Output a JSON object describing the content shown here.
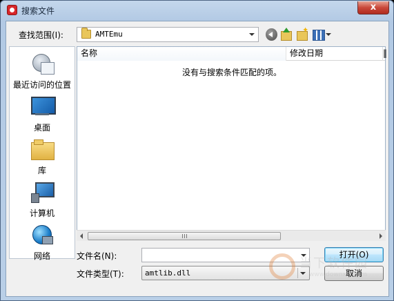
{
  "window": {
    "title": "搜索文件",
    "close_glyph": "x"
  },
  "toolbar": {
    "look_in_label": "查找范围(I):",
    "look_in_value": "AMTEmu"
  },
  "places": [
    {
      "label": "最近访问的位置",
      "icon": "recent-places-icon"
    },
    {
      "label": "桌面",
      "icon": "desktop-icon"
    },
    {
      "label": "库",
      "icon": "library-icon"
    },
    {
      "label": "计算机",
      "icon": "computer-icon"
    },
    {
      "label": "网络",
      "icon": "network-icon"
    }
  ],
  "list": {
    "columns": [
      "名称",
      "修改日期",
      "‖"
    ],
    "empty_message": "没有与搜索条件匹配的项。",
    "scroll_grip": "III"
  },
  "form": {
    "filename_label": "文件名(N):",
    "filename_value": "",
    "filetype_label": "文件类型(T):",
    "filetype_value": "amtlib.dll"
  },
  "buttons": {
    "open": "打开(O)",
    "cancel": "取消"
  },
  "watermark": {
    "text": "当下软件园",
    "url": "www.downxia.com"
  },
  "colors": {
    "title_gradient": "#c4d7ec",
    "close_button": "#c9483a",
    "open_button_border": "#3c7fb1"
  }
}
